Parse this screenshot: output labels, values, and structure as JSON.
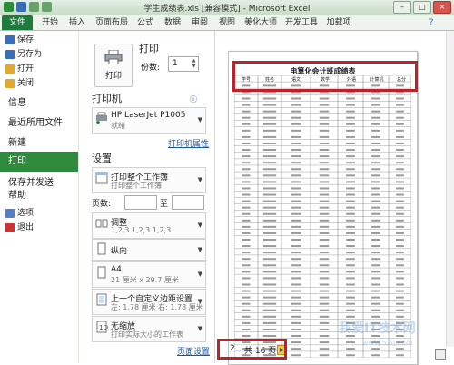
{
  "window": {
    "title": "学生成绩表.xls [兼容模式] - Microsoft Excel",
    "min": "–",
    "max": "□",
    "close": "×"
  },
  "ribbon_tabs": [
    "文件",
    "开始",
    "插入",
    "页面布局",
    "公式",
    "数据",
    "审阅",
    "视图",
    "美化大师",
    "开发工具",
    "加载项"
  ],
  "nav": {
    "items": [
      {
        "label": "保存",
        "icon": "save-icon",
        "color": "#3a6db5"
      },
      {
        "label": "另存为",
        "icon": "save-as-icon",
        "color": "#3a6db5"
      },
      {
        "label": "打开",
        "icon": "open-folder-icon",
        "color": "#e0a82c"
      },
      {
        "label": "关闭",
        "icon": "close-file-icon",
        "color": "#e0a82c"
      }
    ],
    "sections": [
      "信息",
      "最近所用文件",
      "新建",
      "打印",
      "保存并发送",
      "帮助"
    ],
    "bottom": [
      {
        "label": "选项",
        "icon": "options-icon",
        "color": "#5a7fbd"
      },
      {
        "label": "退出",
        "icon": "exit-icon",
        "color": "#cc3333"
      }
    ]
  },
  "print": {
    "heading": "打印",
    "button_label": "打印",
    "copies_label": "份数:",
    "copies_value": "1",
    "printer_heading": "打印机",
    "printer_name": "HP LaserJet P1005",
    "printer_status": "就绪",
    "printer_properties": "打印机属性",
    "settings_heading": "设置",
    "scope_main": "打印整个工作簿",
    "scope_sub": "打印整个工作簿",
    "pages_label": "页数:",
    "pages_to": "至",
    "collate_main": "调整",
    "collate_sub": "1,2,3   1,2,3   1,2,3",
    "orientation": "纵向",
    "paper_main": "A4",
    "paper_sub": "21 厘米 x 29.7 厘米",
    "margins_main": "上一个自定义边距设置",
    "margins_sub": "左: 1.78 厘米  右: 1.78 厘米",
    "scaling_main": "无缩放",
    "scaling_sub": "打印实际大小的工作表",
    "page_setup": "页面设置"
  },
  "preview": {
    "sheet_title": "电算化会计班成绩表",
    "columns": [
      "学号",
      "姓名",
      "语文",
      "数学",
      "外语",
      "计算机",
      "总分"
    ],
    "current_page": "2",
    "total_pages": "共 16 页",
    "watermark": "我爱IT技术网",
    "watermark_url": "www.52ij.com"
  },
  "colors": {
    "accent": "#2e8b3e",
    "highlight": "#c0202a"
  }
}
